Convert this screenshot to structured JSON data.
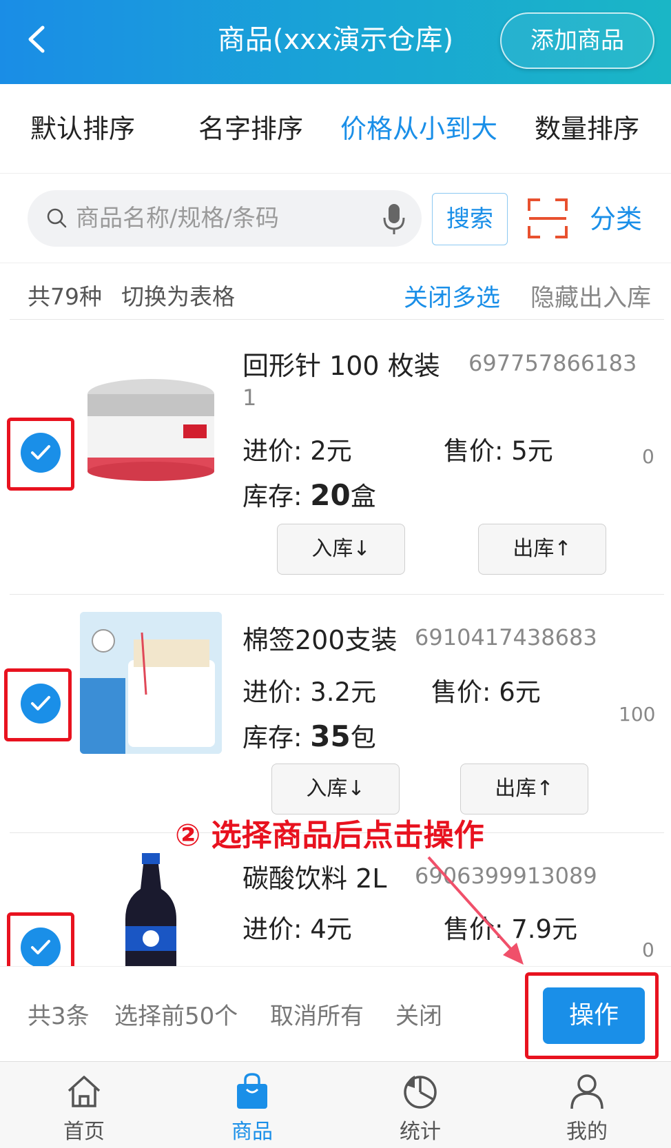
{
  "header": {
    "title": "商品(xxx演示仓库)",
    "add_button": "添加商品"
  },
  "sort_tabs": [
    {
      "label": "默认排序",
      "active": false
    },
    {
      "label": "名字排序",
      "active": false
    },
    {
      "label": "价格从小到大",
      "active": true
    },
    {
      "label": "数量排序",
      "active": false
    }
  ],
  "search": {
    "placeholder": "商品名称/规格/条码",
    "button": "搜索",
    "category": "分类"
  },
  "info": {
    "total": "共79种",
    "toggle_table": "切换为表格",
    "close_multi": "关闭多选",
    "hide_io": "隐藏出入库"
  },
  "products": [
    {
      "name": "回形针 100 枚装",
      "barcode_line1": "697757866183",
      "barcode_line2": "1",
      "purchase_price": "进价: 2元",
      "sale_price": "售价: 5元",
      "stock_label": "库存: ",
      "stock_value": "20",
      "stock_unit": "盒",
      "side_number": "0",
      "in_button": "入库↓",
      "out_button": "出库↑",
      "checked": true
    },
    {
      "name": "棉签200支装",
      "barcode_line1": "6910417438683",
      "purchase_price": "进价: 3.2元",
      "sale_price": "售价: 6元",
      "stock_label": "库存: ",
      "stock_value": "35",
      "stock_unit": "包",
      "side_number": "100",
      "in_button": "入库↓",
      "out_button": "出库↑",
      "checked": true
    },
    {
      "name": "碳酸饮料 2L",
      "barcode_line1": "6906399913089",
      "purchase_price": "进价: 4元",
      "sale_price": "售价: 7.9元",
      "side_number": "0",
      "checked": true
    }
  ],
  "annotation": "② 选择商品后点击操作",
  "action_bar": {
    "count": "共3条",
    "select_first": "选择前50个",
    "cancel_all": "取消所有",
    "close": "关闭",
    "operate": "操作"
  },
  "tabbar": [
    {
      "label": "首页",
      "icon": "home-icon",
      "active": false
    },
    {
      "label": "商品",
      "icon": "shopping-bag-icon",
      "active": true
    },
    {
      "label": "统计",
      "icon": "pie-chart-icon",
      "active": false
    },
    {
      "label": "我的",
      "icon": "user-icon",
      "active": false
    }
  ],
  "colors": {
    "accent": "#1a8fe8",
    "highlight": "#e8121f",
    "header_start": "#1a8de6",
    "header_end": "#1ab6c6"
  }
}
